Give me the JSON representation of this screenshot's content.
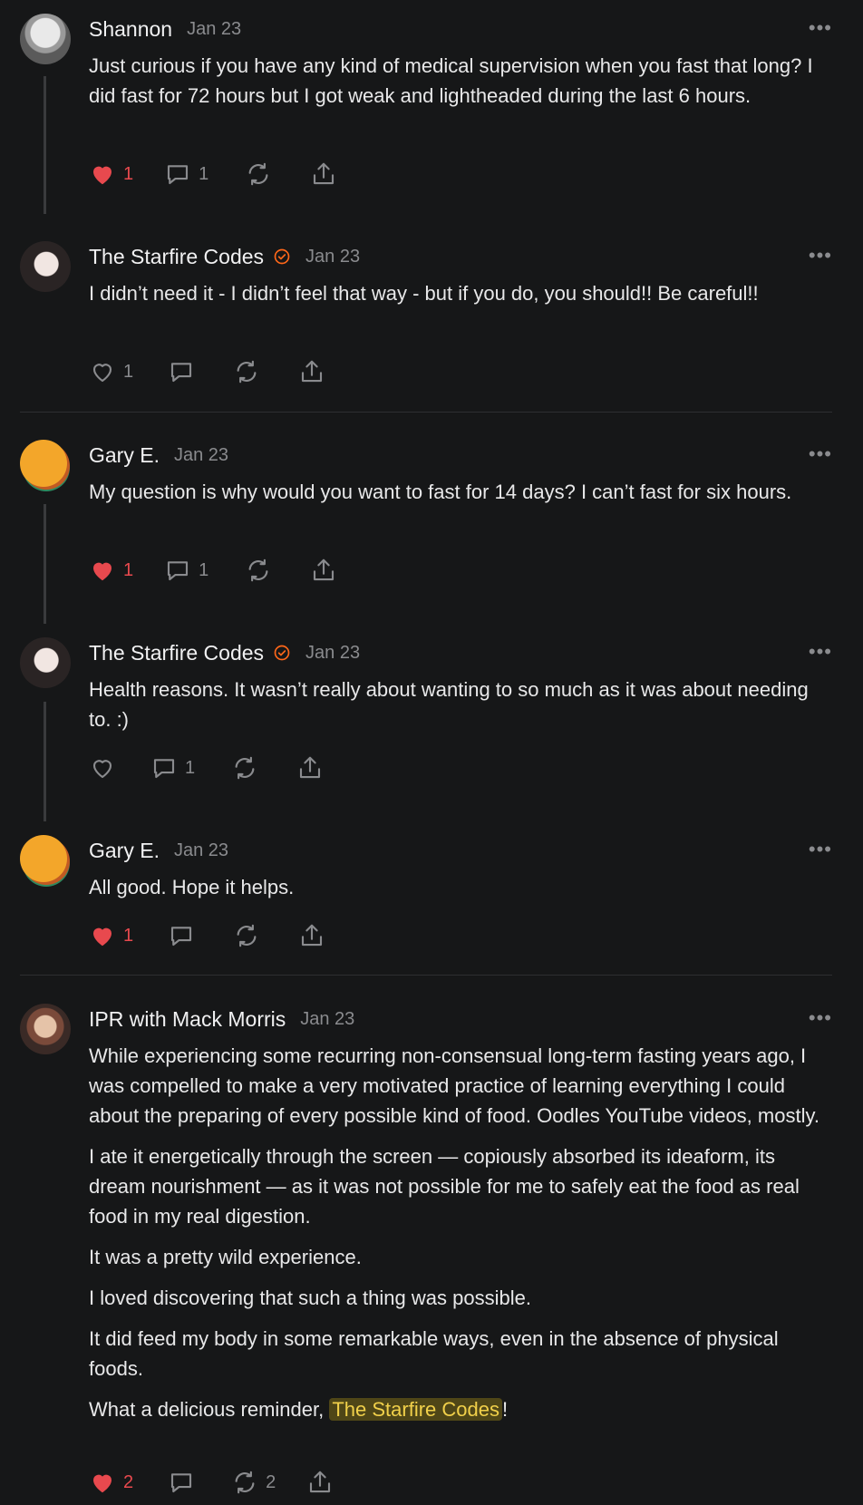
{
  "comments": [
    {
      "name": "Shannon",
      "date": "Jan 23",
      "more": "•••",
      "text": "Just curious if you have any kind of medical supervision when you fast that long? I did fast for 72 hours but I got weak and lightheaded during the last 6 hours.",
      "likes": "1",
      "replies": "1"
    },
    {
      "name": "The Starfire Codes",
      "date": "Jan 23",
      "more": "•••",
      "text": "I didn’t need it - I didn’t feel that way - but if you do, you should!! Be careful!!",
      "likes": "1"
    },
    {
      "name": "Gary E.",
      "date": "Jan 23",
      "more": "•••",
      "text": "My question is why would you want to fast for 14 days? I can’t fast for six hours.",
      "likes": "1",
      "replies": "1"
    },
    {
      "name": "The Starfire Codes",
      "date": "Jan 23",
      "more": "•••",
      "text": "Health reasons. It wasn’t really about wanting to so much as it was about needing to. :)",
      "replies": "1"
    },
    {
      "name": "Gary E.",
      "date": "Jan 23",
      "more": "•••",
      "text": "All good. Hope it helps.",
      "likes": "1"
    },
    {
      "name": "IPR with Mack Morris",
      "date": "Jan 23",
      "more": "•••",
      "paragraphs": [
        "While experiencing some recurring non-consensual long-term fasting years ago, I was compelled to make a very motivated practice of learning everything I could about the preparing of every possible kind of food. Oodles YouTube videos, mostly.",
        "I ate it energetically through the screen — copiously absorbed its ideaform, its dream nourishment — as it was not possible for me to safely eat the food as real food in my real digestion.",
        "It was a pretty wild experience.",
        "I loved discovering that such a thing was possible.",
        "It did feed my body in some remarkable ways, even in the absence of physical foods."
      ],
      "last_prefix": "What a delicious reminder, ",
      "mention": "The Starfire Codes",
      "last_suffix": "!",
      "likes": "2",
      "restacks": "2"
    }
  ],
  "colors": {
    "background": "#161718",
    "like_active": "#e8494e",
    "verified": "#ff6719",
    "mention_bg": "#4f4617",
    "mention_text": "#f1d04a"
  },
  "icons": [
    "heart-icon",
    "comment-icon",
    "restack-icon",
    "share-icon",
    "more-icon",
    "verified-check-icon"
  ]
}
